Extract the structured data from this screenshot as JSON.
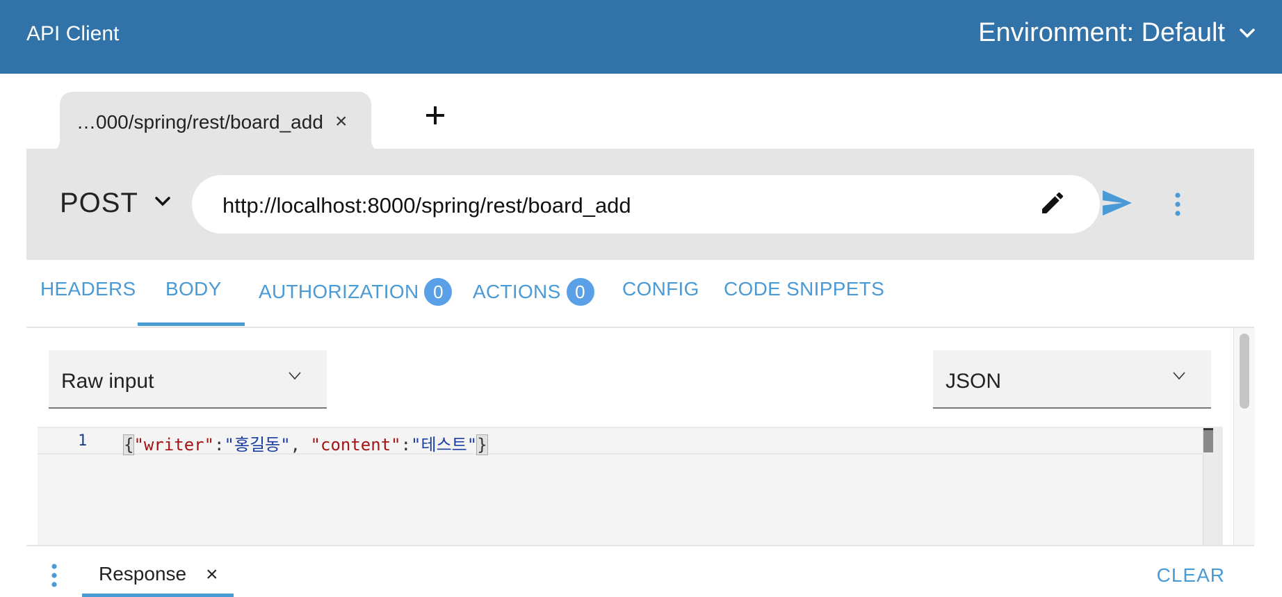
{
  "header": {
    "app_title": "API Client",
    "environment_label": "Environment: Default"
  },
  "tabs": {
    "active_tab_label": "…000/spring/rest/board_add",
    "close_glyph": "×"
  },
  "request": {
    "method": "POST",
    "url": "http://localhost:8000/spring/rest/board_add"
  },
  "section_tabs": [
    {
      "label": "HEADERS"
    },
    {
      "label": "BODY",
      "active": true
    },
    {
      "label": "AUTHORIZATION",
      "badge": "0"
    },
    {
      "label": "ACTIONS",
      "badge": "0"
    },
    {
      "label": "CONFIG"
    },
    {
      "label": "CODE SNIPPETS"
    }
  ],
  "body": {
    "input_mode": "Raw input",
    "content_type": "JSON",
    "editor": {
      "line_number": "1",
      "open_brace": "{",
      "key1": "\"writer\"",
      "colon": ":",
      "value1": "\"홍길동\"",
      "comma": ", ",
      "key2": "\"content\"",
      "value2": "\"테스트\"",
      "close_brace": "}"
    }
  },
  "response": {
    "tab_label": "Response",
    "close_glyph": "×",
    "clear_label": "CLEAR"
  },
  "colors": {
    "accent": "#3172a8",
    "link": "#4a9ad6",
    "badge": "#5aa0e6"
  }
}
